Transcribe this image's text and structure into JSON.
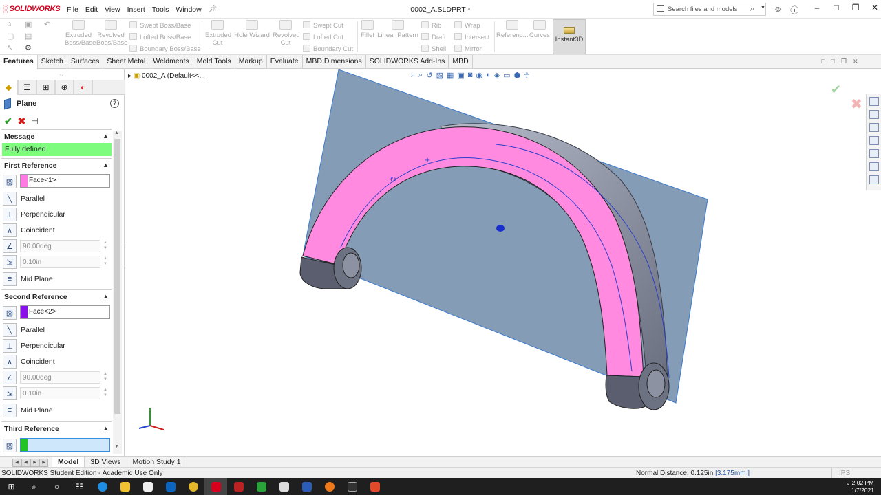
{
  "app": {
    "logo": "SOLIDWORKS",
    "menu": [
      "File",
      "Edit",
      "View",
      "Insert",
      "Tools",
      "Window"
    ],
    "title": "0002_A.SLDPRT *",
    "search_placeholder": "Search files and models"
  },
  "commands": {
    "extruded_boss": "Extruded Boss/Base",
    "revolved_boss": "Revolved Boss/Base",
    "swept_boss": "Swept Boss/Base",
    "lofted_boss": "Lofted Boss/Base",
    "boundary_boss": "Boundary Boss/Base",
    "extruded_cut": "Extruded Cut",
    "hole_wizard": "Hole Wizard",
    "revolved_cut": "Revolved Cut",
    "swept_cut": "Swept Cut",
    "lofted_cut": "Lofted Cut",
    "boundary_cut": "Boundary Cut",
    "fillet": "Fillet",
    "linear_pattern": "Linear Pattern",
    "rib": "Rib",
    "draft": "Draft",
    "shell": "Shell",
    "wrap": "Wrap",
    "intersect": "Intersect",
    "mirror": "Mirror",
    "reference": "Referenc...",
    "curves": "Curves",
    "instant3d": "Instant3D"
  },
  "tabs": [
    "Features",
    "Sketch",
    "Surfaces",
    "Sheet Metal",
    "Weldments",
    "Mold Tools",
    "Markup",
    "Evaluate",
    "MBD Dimensions",
    "SOLIDWORKS Add-Ins",
    "MBD"
  ],
  "property_manager": {
    "title": "Plane",
    "message_header": "Message",
    "message": "Fully defined",
    "first_ref": {
      "header": "First Reference",
      "selection": "Face<1>",
      "selection_color": "#ff7be1",
      "parallel": "Parallel",
      "perpendicular": "Perpendicular",
      "coincident": "Coincident",
      "angle": "90.00deg",
      "distance": "0.10in",
      "mid_plane": "Mid Plane"
    },
    "second_ref": {
      "header": "Second Reference",
      "selection": "Face<2>",
      "selection_color": "#8a12e8",
      "parallel": "Parallel",
      "perpendicular": "Perpendicular",
      "coincident": "Coincident",
      "angle": "90.00deg",
      "distance": "0.10in",
      "mid_plane": "Mid Plane"
    },
    "third_ref": {
      "header": "Third Reference",
      "selection": "",
      "selection_color": "#22c322"
    }
  },
  "tree": {
    "root": "0002_A  (Default<<..."
  },
  "bottom_tabs": [
    "Model",
    "3D Views",
    "Motion Study 1"
  ],
  "status": {
    "left": "SOLIDWORKS Student Edition - Academic Use Only",
    "normal_distance": "Normal Distance: 0.125in",
    "normal_distance_mm": "[3.175mm ]",
    "units": "IPS"
  },
  "clock": {
    "time": "2:02 PM",
    "date": "1/7/2021"
  },
  "colors": {
    "plane_fill": "#6f8ba8",
    "face_highlight": "#ff8ae0",
    "part_body": "#8a8fa3",
    "message_bg": "#7dfc7d",
    "accent_blue": "#2456a6"
  }
}
